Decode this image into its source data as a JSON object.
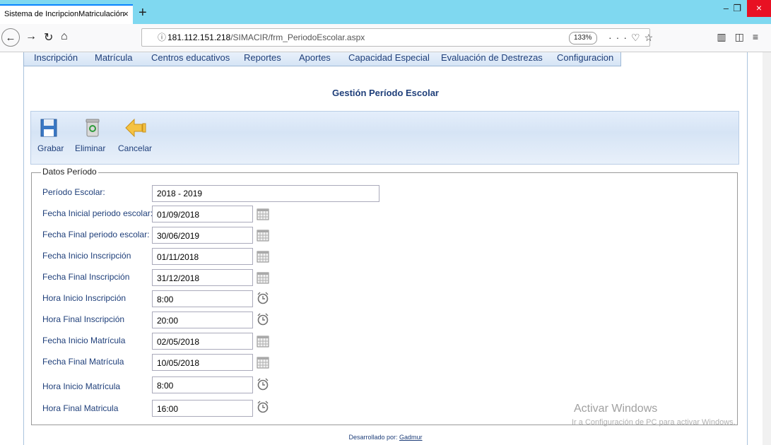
{
  "browser": {
    "tab_title": "Sistema de IncripcionMatriculación",
    "tab_close": "×",
    "new_tab": "+",
    "url_host": "181.112.151.218",
    "url_path": "/SIMACIR/frm_PeriodoEscolar.aspx",
    "zoom": "133%",
    "window_controls": {
      "minimize": "–",
      "restore": "❐",
      "close": "×"
    }
  },
  "menu": {
    "items": [
      "Inscripción",
      "Matrícula",
      "Centros educativos",
      "Reportes",
      "Aportes",
      "Capacidad Especial",
      "Evaluación de Destrezas",
      "Configuracion"
    ]
  },
  "page": {
    "title": "Gestión Período Escolar"
  },
  "toolbar": {
    "save_label": "Grabar",
    "delete_label": "Eliminar",
    "cancel_label": "Cancelar"
  },
  "form": {
    "legend": "Datos Período",
    "fields": [
      {
        "label": "Período Escolar:",
        "value": "2018 - 2019",
        "picker": "none"
      },
      {
        "label": "Fecha Inicial periodo escolar:",
        "value": "01/09/2018",
        "picker": "calendar-icon"
      },
      {
        "label": "Fecha Final periodo escolar:",
        "value": "30/06/2019",
        "picker": "calendar-icon"
      },
      {
        "label": "Fecha Inicio Inscripción",
        "value": "01/11/2018",
        "picker": "calendar-icon"
      },
      {
        "label": "Fecha Final Inscripción",
        "value": "31/12/2018",
        "picker": "calendar-icon"
      },
      {
        "label": "Hora Inicio Inscripción",
        "value": "8:00",
        "picker": "clock-icon"
      },
      {
        "label": "Hora Final Inscripción",
        "value": "20:00",
        "picker": "clock-icon"
      },
      {
        "label": "Fecha Inicio Matrícula",
        "value": "02/05/2018",
        "picker": "calendar-icon"
      },
      {
        "label": "Fecha Final Matrícula",
        "value": "10/05/2018",
        "picker": "calendar-icon"
      },
      {
        "label": "Hora Inicio Matrícula",
        "value": "8:00",
        "picker": "clock-icon"
      },
      {
        "label": "Hora Final Matricula",
        "value": "16:00",
        "picker": "clock-icon"
      }
    ]
  },
  "watermark": {
    "line1": "Activar Windows",
    "line2": "Ir a Configuración de PC para activar Windows."
  },
  "footer": {
    "text": "Desarrollado por:",
    "link": "Gadmur"
  }
}
